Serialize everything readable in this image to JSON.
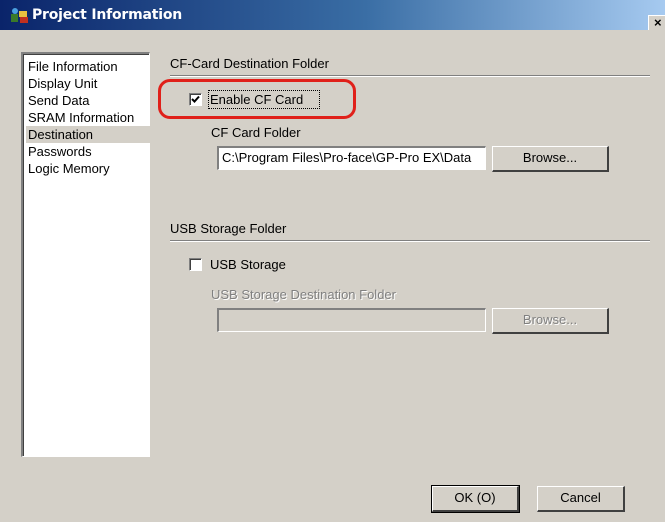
{
  "window": {
    "title": "Project Information",
    "close_glyph": "×"
  },
  "nav": {
    "items": [
      {
        "label": "File Information",
        "selected": false
      },
      {
        "label": "Display Unit",
        "selected": false
      },
      {
        "label": "Send Data",
        "selected": false
      },
      {
        "label": "SRAM Information",
        "selected": false
      },
      {
        "label": "Destination",
        "selected": true
      },
      {
        "label": "Passwords",
        "selected": false
      },
      {
        "label": "Logic Memory",
        "selected": false
      }
    ]
  },
  "cf_group": {
    "title": "CF-Card Destination Folder",
    "enable_label": "Enable CF Card",
    "enable_checked": true,
    "folder_label": "CF Card Folder",
    "folder_value": "C:\\Program Files\\Pro-face\\GP-Pro EX\\Data",
    "browse_label": "Browse..."
  },
  "usb_group": {
    "title": "USB Storage Folder",
    "usb_label": "USB Storage",
    "usb_checked": false,
    "folder_label": "USB Storage Destination Folder",
    "folder_value": "",
    "browse_label": "Browse..."
  },
  "footer": {
    "ok_label": "OK (O)",
    "cancel_label": "Cancel"
  },
  "colors": {
    "highlight": "#e0201a",
    "titlebar": "#0a246a"
  }
}
